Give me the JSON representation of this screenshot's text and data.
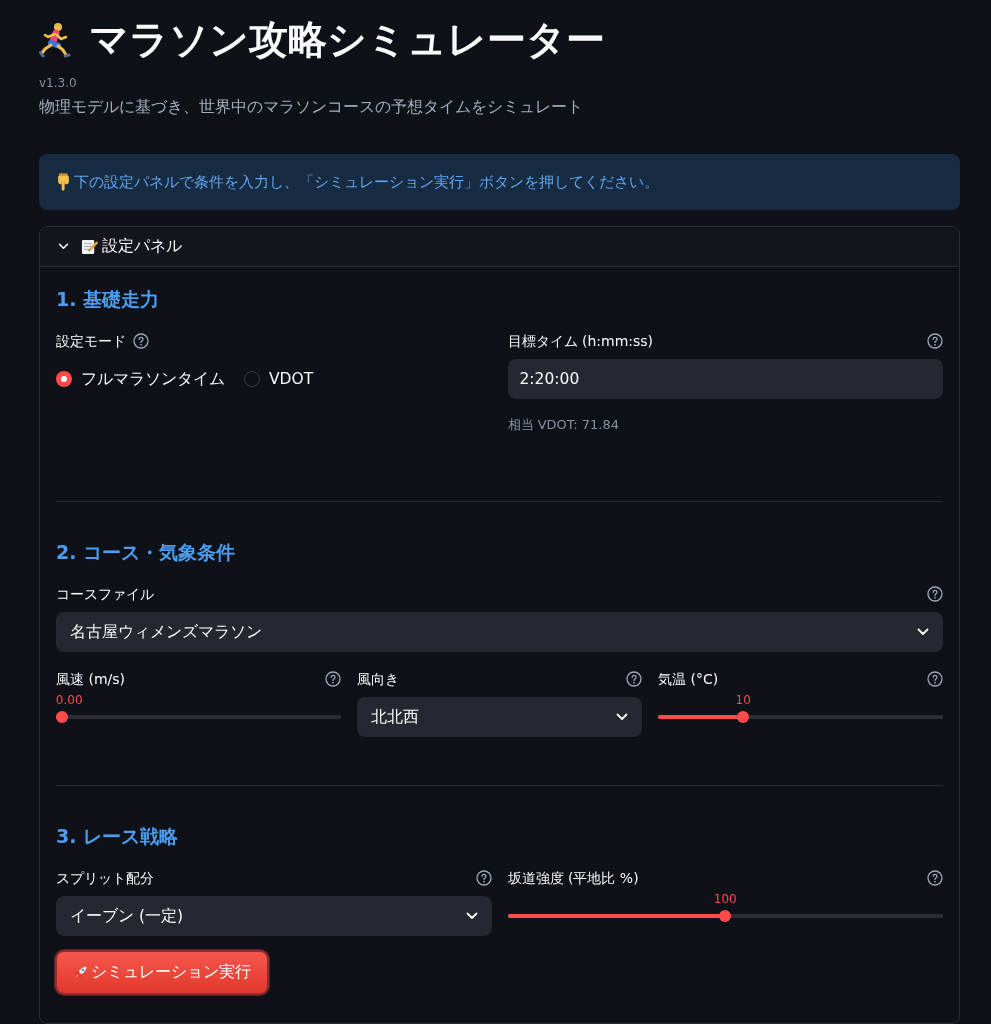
{
  "header": {
    "title": "マラソン攻略シミュレーター",
    "version": "v1.3.0",
    "subtitle": "物理モデルに基づき、世界中のマラソンコースの予想タイムをシミュレート"
  },
  "info_banner": {
    "text": "下の設定パネルで条件を入力し、「シミュレーション実行」ボタンを押してください。"
  },
  "expander": {
    "title": "設定パネル",
    "expanded": true,
    "sections": [
      {
        "heading": "1. 基礎走力",
        "rows": [
          {
            "fields": [
              {
                "kind": "radio",
                "label": "設定モード",
                "help": true,
                "options": [
                  {
                    "label": "フルマラソンタイム",
                    "selected": true
                  },
                  {
                    "label": "VDOT",
                    "selected": false
                  }
                ]
              },
              {
                "kind": "text_input",
                "label": "目標タイム (h:mm:ss)",
                "help": true,
                "value": "2:20:00",
                "caption": "相当 VDOT: 71.84"
              }
            ]
          }
        ]
      },
      {
        "heading": "2. コース・気象条件",
        "rows": [
          {
            "fields": [
              {
                "kind": "select",
                "label": "コースファイル",
                "help": true,
                "value": "名古屋ウィメンズマラソン"
              }
            ]
          },
          {
            "fields": [
              {
                "kind": "slider",
                "label": "風速 (m/s)",
                "help": true,
                "value": "0.00",
                "level": 0
              },
              {
                "kind": "select",
                "label": "風向き",
                "help": true,
                "value": "北北西"
              },
              {
                "kind": "slider",
                "label": "気温 (°C)",
                "help": true,
                "value": "10",
                "level": 0.29
              }
            ]
          }
        ]
      },
      {
        "heading": "3. レース戦略",
        "rows": [
          {
            "fields": [
              {
                "kind": "select",
                "label": "スプリット配分",
                "help": true,
                "value": "イーブン (一定)"
              },
              {
                "kind": "slider",
                "label": "坂道強度 (平地比 %)",
                "help": true,
                "value": "100",
                "level": 0.5
              }
            ]
          }
        ]
      }
    ],
    "run_button": {
      "label": "シミュレーション実行"
    }
  }
}
